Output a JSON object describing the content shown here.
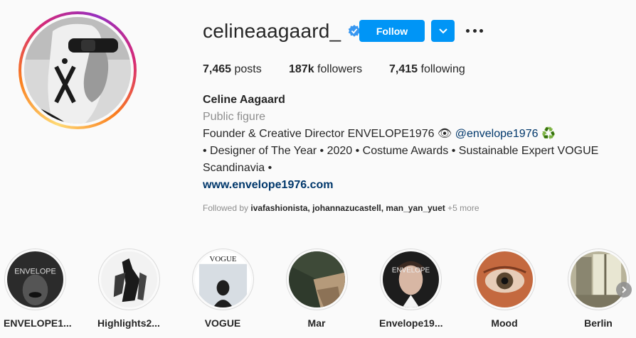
{
  "profile": {
    "username": "celineaagaard_",
    "verified_icon": "verified-badge-icon",
    "follow_label": "Follow",
    "dropdown_icon": "chevron-down-icon",
    "more_icon": "more-options-icon",
    "accent_color": "#0095f6"
  },
  "stats": {
    "posts_count": "7,465",
    "posts_label": "posts",
    "followers_count": "187k",
    "followers_label": "followers",
    "following_count": "7,415",
    "following_label": "following"
  },
  "bio": {
    "full_name": "Celine Aagaard",
    "category": "Public figure",
    "line1_text": "Founder & Creative Director ENVELOPE1976 👁",
    "line1_mention": "@envelope1976",
    "line1_emoji": "♻️",
    "line2": "• Designer of The Year • 2020 • Costume Awards • Sustainable Expert VOGUE",
    "line3": "Scandinavia •",
    "url": "www.envelope1976.com"
  },
  "followed_by": {
    "prefix": "Followed by",
    "names": "ivafashionista, johannazucastell, man_yan_yuet",
    "more": "+5 more"
  },
  "highlights": [
    {
      "label": "ENVELOPE1...",
      "cover_text": "ENVELOPE"
    },
    {
      "label": "Highlights2...",
      "cover_text": ""
    },
    {
      "label": "VOGUE",
      "cover_text": "VOGUE"
    },
    {
      "label": "Mar",
      "cover_text": ""
    },
    {
      "label": "Envelope19...",
      "cover_text": "ENVELOPE"
    },
    {
      "label": "Mood",
      "cover_text": ""
    },
    {
      "label": "Berlin",
      "cover_text": ""
    }
  ]
}
